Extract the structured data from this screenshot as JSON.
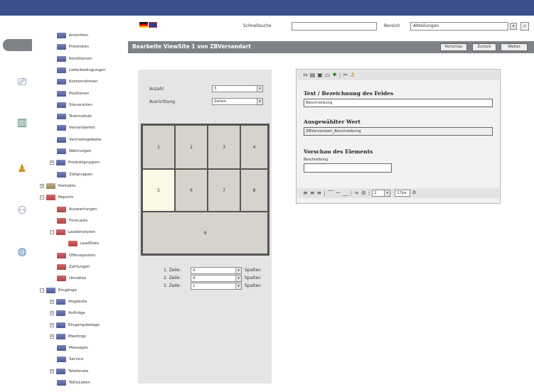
{
  "header": {
    "quicksearch_label": "Schnellsuche",
    "quicksearch_value": "",
    "area_label": "Bereich",
    "area_value": "Abteilungen"
  },
  "titlebar": {
    "title": "Bearbeite ViewSite 1 von ZBVersandart",
    "buttons": [
      "Vorschau",
      "Zurück",
      "Weiter"
    ]
  },
  "tree": {
    "items": [
      {
        "label": "Ansichten",
        "icon": "blue",
        "toggle": ""
      },
      {
        "label": "Preislisten",
        "icon": "blue",
        "toggle": ""
      },
      {
        "label": "Konditionen",
        "icon": "blue",
        "toggle": ""
      },
      {
        "label": "Lieferbedingungen",
        "icon": "blue",
        "toggle": ""
      },
      {
        "label": "Kontenrahmen",
        "icon": "blue",
        "toggle": ""
      },
      {
        "label": "Positionen",
        "icon": "blue",
        "toggle": ""
      },
      {
        "label": "Steuerarten",
        "icon": "blue",
        "toggle": ""
      },
      {
        "label": "Textmodule",
        "icon": "blue",
        "toggle": ""
      },
      {
        "label": "Versandarten",
        "icon": "blue",
        "toggle": ""
      },
      {
        "label": "Vertriebsgebiete",
        "icon": "blue",
        "toggle": ""
      },
      {
        "label": "Währungen",
        "icon": "blue",
        "toggle": ""
      },
      {
        "label": "Produktgruppen",
        "icon": "blue",
        "toggle": "+"
      },
      {
        "label": "Zielgruppen",
        "icon": "blue",
        "toggle": ""
      },
      {
        "label": "Kontakte",
        "icon": "brown",
        "toggle": "+"
      },
      {
        "label": "Reports",
        "icon": "red",
        "toggle": "−"
      },
      {
        "label": "Auswertungen",
        "icon": "red",
        "toggle": ""
      },
      {
        "label": "Forecasts",
        "icon": "red",
        "toggle": ""
      },
      {
        "label": "Leadanalysen",
        "icon": "red",
        "toggle": "−"
      },
      {
        "label": "LeadDate",
        "icon": "red",
        "toggle": ""
      },
      {
        "label": "Offeneposten",
        "icon": "red",
        "toggle": ""
      },
      {
        "label": "Zahlungen",
        "icon": "red",
        "toggle": ""
      },
      {
        "label": "Umsätze",
        "icon": "red",
        "toggle": ""
      },
      {
        "label": "Eingänge",
        "icon": "blue",
        "toggle": "−"
      },
      {
        "label": "Angebote",
        "icon": "blue",
        "toggle": "+"
      },
      {
        "label": "Aufträge",
        "icon": "blue",
        "toggle": "+"
      },
      {
        "label": "Eingangsbelege",
        "icon": "blue",
        "toggle": "+"
      },
      {
        "label": "Meetings",
        "icon": "blue",
        "toggle": "+"
      },
      {
        "label": "Messages",
        "icon": "blue",
        "toggle": ""
      },
      {
        "label": "Service",
        "icon": "blue",
        "toggle": ""
      },
      {
        "label": "Telefonate",
        "icon": "blue",
        "toggle": "+"
      },
      {
        "label": "ToDoListen",
        "icon": "blue",
        "toggle": ""
      }
    ]
  },
  "grid_settings": {
    "count_label": "Anzahl",
    "count_value": "3",
    "align_label": "Ausrichtung",
    "align_value": "Zeilen",
    "cells_row1": [
      "1",
      "2",
      "3",
      "4"
    ],
    "cells_row2": [
      "5",
      "6",
      "7",
      "8"
    ],
    "cell_row3": "9",
    "rows": [
      {
        "label": "1. Zeile:",
        "value": "4",
        "unit": "Spalten"
      },
      {
        "label": "2. Zeile:",
        "value": "4",
        "unit": "Spalten"
      },
      {
        "label": "3. Zeile:",
        "value": "1",
        "unit": "Spalten"
      }
    ]
  },
  "editor": {
    "text_heading": "Text / Bezeichnung des Feldes",
    "text_value": "Beschreibung",
    "selected_heading": "Ausgewählter Wert",
    "selected_value": "ZBVersandart_Beschreibung",
    "preview_heading": "Vorschau des Elements",
    "preview_label": "Beschreibung",
    "size_value": "2",
    "pixel_value": "17px",
    "pixel_suffix": "D"
  },
  "colors": {
    "topbar": "#3a4f8c",
    "titlebar": "#7f8387",
    "selected_cell": "#fbf9e6"
  }
}
